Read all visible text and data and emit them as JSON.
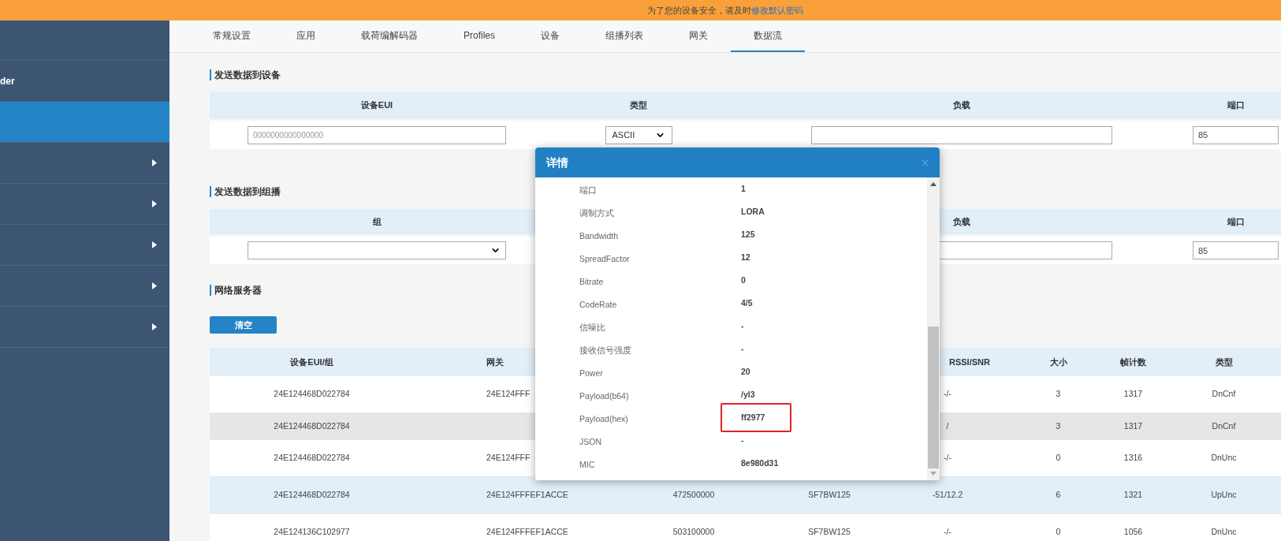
{
  "banner": {
    "text": "为了您的设备安全，请及时",
    "link": "修改默认密码"
  },
  "sidebar": {
    "items": [
      {
        "label": "der",
        "selected": false,
        "expandable": false
      },
      {
        "selected": true,
        "expandable": false
      },
      {
        "selected": false,
        "expandable": true
      },
      {
        "selected": false,
        "expandable": true
      },
      {
        "selected": false,
        "expandable": true
      },
      {
        "selected": false,
        "expandable": true
      },
      {
        "selected": false,
        "expandable": true
      }
    ]
  },
  "tabs": [
    {
      "label": "常规设置",
      "selected": false
    },
    {
      "label": "应用",
      "selected": false
    },
    {
      "label": "载荷编解码器",
      "selected": false
    },
    {
      "label": "Profiles",
      "selected": false
    },
    {
      "label": "设备",
      "selected": false
    },
    {
      "label": "组播列表",
      "selected": false
    },
    {
      "label": "网关",
      "selected": false
    },
    {
      "label": "数据流",
      "selected": true
    }
  ],
  "send_to_device": {
    "title": "发送数据到设备",
    "columns": [
      "设备EUI",
      "类型",
      "负载",
      "端口"
    ],
    "eui_placeholder": "0000000000000000",
    "type_value": "ASCII",
    "port_value": "85"
  },
  "send_to_group": {
    "title": "发送数据到组播",
    "columns": [
      "组",
      null,
      "负载",
      "端口"
    ],
    "port_value": "85"
  },
  "network_server": {
    "title": "网络服务器",
    "clear_button": "清空",
    "columns": [
      "设备EUI/组",
      "网关",
      null,
      null,
      "RSSI/SNR",
      "大小",
      "帧计数",
      "类型"
    ],
    "rows": [
      {
        "kind": "none",
        "cells": [
          "24E124468D022784",
          "24E124FFF",
          null,
          null,
          "-/-",
          "3",
          "1317",
          "DnCnf"
        ]
      },
      {
        "kind": "hover",
        "cells": [
          "24E124468D022784",
          null,
          null,
          null,
          "/",
          "3",
          "1317",
          "DnCnf"
        ]
      },
      {
        "kind": "none",
        "cells": [
          "24E124468D022784",
          "24E124FFF",
          null,
          null,
          "-/-",
          "0",
          "1316",
          "DnUnc"
        ]
      },
      {
        "kind": "uplink",
        "cells": [
          "24E124468D022784",
          "24E124FFFEF1ACCE",
          "472500000",
          "SF7BW125",
          "-51/12.2",
          "6",
          "1321",
          "UpUnc"
        ]
      },
      {
        "kind": "none",
        "cells": [
          "24E124136C102977",
          "24E124FFFEF1ACCE",
          "503100000",
          "SF7BW125",
          "-/-",
          "0",
          "1056",
          "DnUnc"
        ]
      }
    ]
  },
  "modal": {
    "title": "详情",
    "fields": [
      {
        "label": "端口",
        "value": "1",
        "highlighted": false
      },
      {
        "label": "调制方式",
        "value": "LORA",
        "highlighted": false
      },
      {
        "label": "Bandwidth",
        "value": "125",
        "highlighted": false
      },
      {
        "label": "SpreadFactor",
        "value": "12",
        "highlighted": false
      },
      {
        "label": "Bitrate",
        "value": "0",
        "highlighted": false
      },
      {
        "label": "CodeRate",
        "value": "4/5",
        "highlighted": false
      },
      {
        "label": "信噪比",
        "value": "-",
        "highlighted": false
      },
      {
        "label": "接收信号强度",
        "value": "-",
        "highlighted": false
      },
      {
        "label": "Power",
        "value": "20",
        "highlighted": false
      },
      {
        "label": "Payload(b64)",
        "value": "/yl3",
        "highlighted": false
      },
      {
        "label": "Payload(hex)",
        "value": "ff2977",
        "highlighted": true
      },
      {
        "label": "JSON",
        "value": "-",
        "highlighted": false
      },
      {
        "label": "MIC",
        "value": "8e980d31",
        "highlighted": false
      }
    ]
  }
}
